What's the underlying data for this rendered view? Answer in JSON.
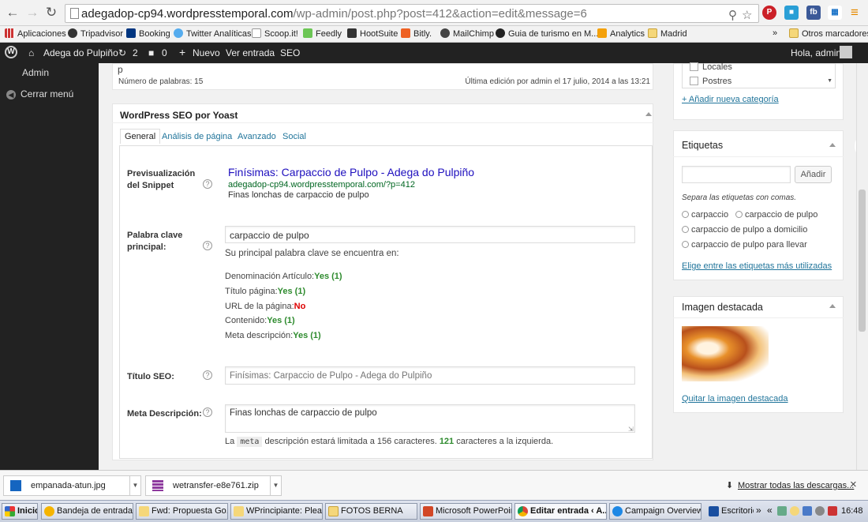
{
  "browser": {
    "url_host": "adegadop-cp94.wordpresstemporal.com",
    "url_path": "/wp-admin/post.php?post=412&action=edit&message=6"
  },
  "bookmarks": {
    "apps": "Aplicaciones",
    "items": [
      "Tripadvisor",
      "Booking",
      "Twitter Analíticas",
      "Scoop.it!",
      "Feedly",
      "HootSuite",
      "Bitly.",
      "MailChimp",
      "Guia de turismo en M...",
      "Analytics",
      "Madrid"
    ],
    "overflow": "»",
    "other": "Otros marcadores"
  },
  "adminbar": {
    "site": "Adega do Pulpiño",
    "updates": "2",
    "comments": "0",
    "new": "Nuevo",
    "view": "Ver entrada",
    "seo": "SEO",
    "greeting": "Hola, admin"
  },
  "leftmenu": {
    "admin": "Admin",
    "collapse": "Cerrar menú"
  },
  "editor": {
    "p": "p",
    "word_count": "Número de palabras: 15",
    "last_edit": "Última edición por admin el 17 julio, 2014 a las 13:21"
  },
  "seo": {
    "title": "WordPress SEO por Yoast",
    "tabs": [
      "General",
      "Análisis de página",
      "Avanzado",
      "Social"
    ],
    "snippet_label": "Previsualización del Snippet",
    "snippet_title": "Finísimas: Carpaccio de Pulpo - Adega do Pulpiño",
    "snippet_url": "adegadop-cp94.wordpresstemporal.com/?p=412",
    "snippet_desc": "Finas lonchas de carpaccio de pulpo",
    "keyword_label": "Palabra clave principal:",
    "keyword_value": "carpaccio de pulpo",
    "found_in": "Su principal palabra clave se encuentra en:",
    "checks": [
      {
        "label": "Denominación Artículo:",
        "result": "Yes (1)"
      },
      {
        "label": "Título página:",
        "result": "Yes (1)"
      },
      {
        "label": "URL de la página:",
        "result": "No"
      },
      {
        "label": "Contenido:",
        "result": "Yes (1)"
      },
      {
        "label": "Meta descripción:",
        "result": "Yes (1)"
      }
    ],
    "seo_title_label": "Título SEO:",
    "seo_title_placeholder": "Finísimas: Carpaccio de Pulpo - Adega do Pulpiño",
    "meta_label": "Meta Descripción:",
    "meta_value": "Finas lonchas de carpaccio de pulpo",
    "meta_note_pre": "La",
    "meta_code": "meta",
    "meta_note_mid": "descripción estará limitada a 156 caracteres.",
    "meta_count": "121",
    "meta_note_post": "caracteres a la izquierda."
  },
  "categories": {
    "items": [
      "Locales",
      "Postres"
    ],
    "add": "+ Añadir nueva categoría"
  },
  "tags": {
    "title": "Etiquetas",
    "add_button": "Añadir",
    "hint": "Separa las etiquetas con comas.",
    "items": [
      "carpaccio",
      "carpaccio de pulpo",
      "carpaccio de pulpo a domicilio",
      "carpaccio de pulpo para llevar"
    ],
    "choose": "Elige entre las etiquetas más utilizadas"
  },
  "featured": {
    "title": "Imagen destacada",
    "remove": "Quitar la imagen destacada"
  },
  "downloads": {
    "files": [
      "empanada-atun.jpg",
      "wetransfer-e8e761.zip"
    ],
    "show_all": "Mostrar todas las descargas...",
    "close": "×"
  },
  "taskbar": {
    "start": "Inicio",
    "items": [
      "Bandeja de entrada...",
      "Fwd: Propuesta Go...",
      "WPrincipiante: Plea...",
      "FOTOS BERNA",
      "Microsoft PowerPoin...",
      "Editar entrada ‹ A...",
      "Campaign Overview...",
      "Escritorio"
    ],
    "overflow": "»",
    "tray_overflow": "«",
    "clock": "16:48"
  }
}
